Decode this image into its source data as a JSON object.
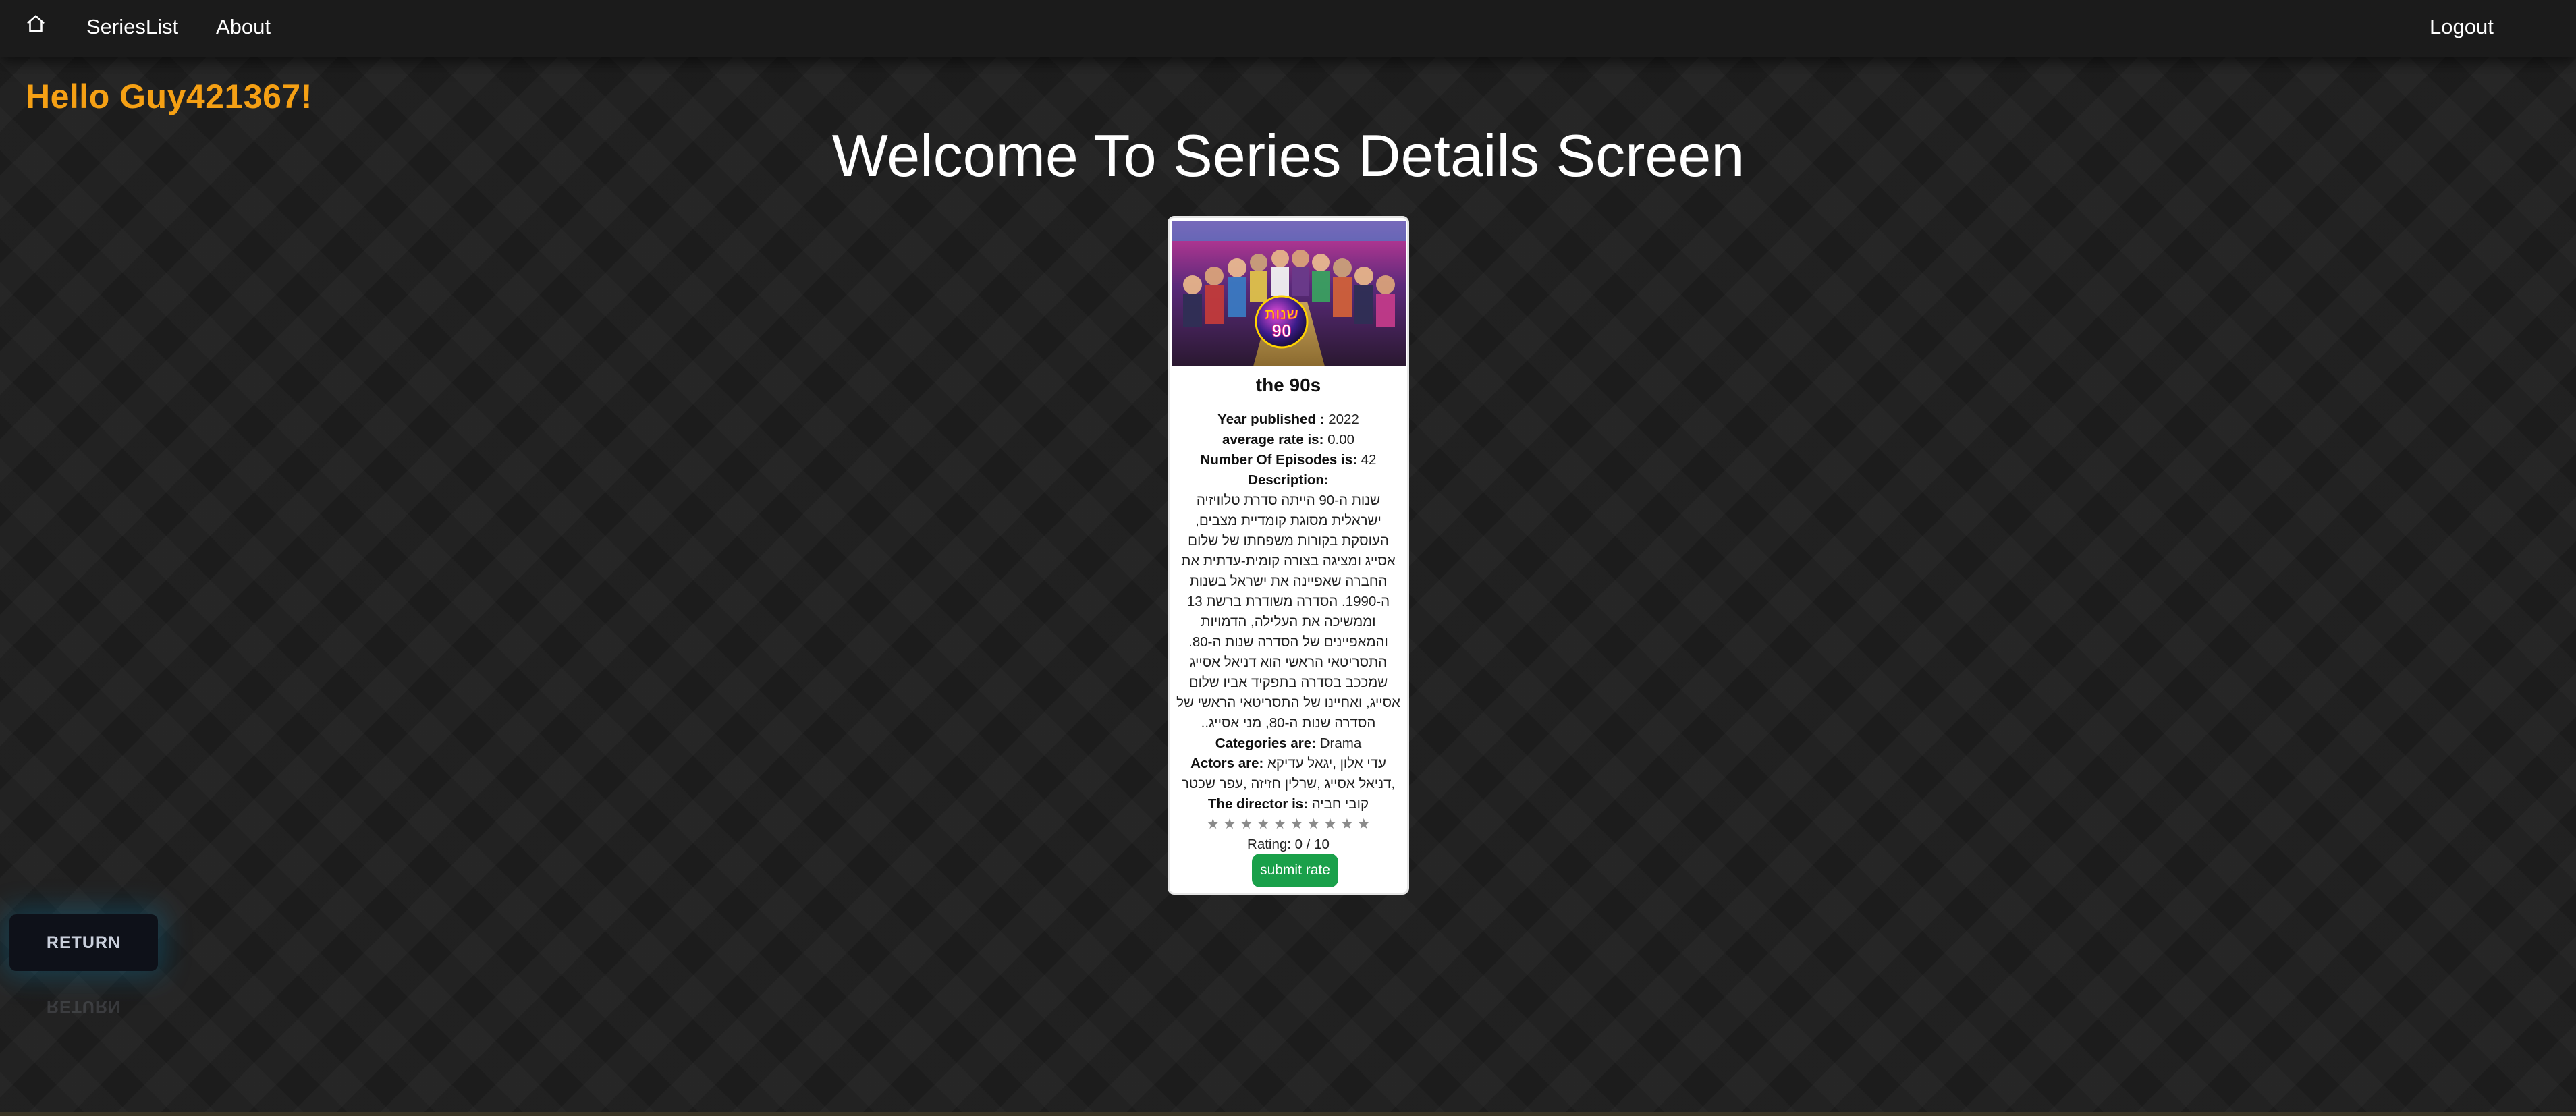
{
  "nav": {
    "home_icon": "home-icon",
    "serieslist_label": "SeriesList",
    "about_label": "About",
    "logout_label": "Logout",
    "theme_icon": "moon-icon"
  },
  "greeting": "Hello Guy421367!",
  "page_title": "Welcome To Series Details Screen",
  "series": {
    "title": "the 90s",
    "year_label": "Year published :",
    "year_value": "2022",
    "avg_label": "average rate is:",
    "avg_value": "0.00",
    "episodes_label": "Number Of Episodes is:",
    "episodes_value": "42",
    "description_label": "Description:",
    "description": "שנות ה-90 הייתה סדרת טלוויזיה ישראלית מסוגת קומדיית מצבים, העוסקת בקורות משפחתו של שלום אסייג ומציגה בצורה קומית-עדתית את החברה שאפיינה את ישראל בשנות ה-1990. הסדרה משודרת ברשת 13 וממשיכה את העלילה, הדמויות והמאפיינים של הסדרה שנות ה-80. התסריטאי הראשי הוא דניאל אסייג שמככב בסדרה בתפקיד אביו שלום אסייג, ואחיינו של התסריטאי הראשי של הסדרה שנות ה-80, מני אסייג..",
    "categories_label": "Categories are:",
    "categories_value": "Drama",
    "actors_label": "Actors are:",
    "actors_value": "עדי אלון ,יגאל עדיקא ,דניאל אסייג ,שרלין חזיזה ,עפר שכטר",
    "director_label": "The director is:",
    "director_value": "קובי חביה",
    "stars": "★★★★★★★★★★",
    "rating_text": "Rating: 0 / 10",
    "rating_value": 0,
    "rating_max": 10,
    "submit_label": "submit rate"
  },
  "return_label": "RETURN",
  "colors": {
    "greeting": "#f5a014",
    "submit_button": "#1aa04a",
    "background": "#1f1f1f"
  }
}
